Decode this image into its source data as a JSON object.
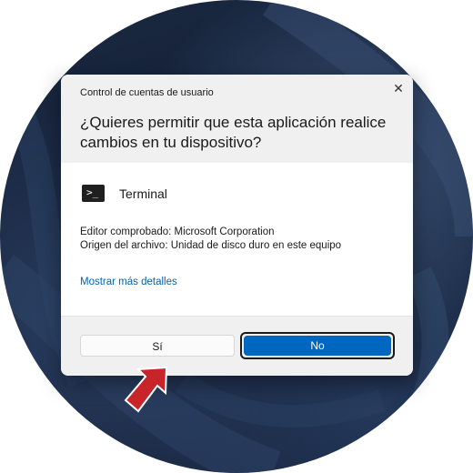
{
  "dialog": {
    "window_title": "Control de cuentas de usuario",
    "question": "¿Quieres permitir que esta aplicación realice cambios en tu dispositivo?",
    "app_name": "Terminal",
    "publisher": "Editor comprobado: Microsoft Corporation",
    "origin": "Origen del archivo: Unidad de disco duro en este equipo",
    "details_link": "Mostrar más detalles",
    "yes_label": "Sí",
    "no_label": "No",
    "close_glyph": "✕",
    "app_icon_glyph": ">_"
  },
  "colors": {
    "primary_button": "#0067c0",
    "link": "#0063b1",
    "arrow": "#c8252b"
  },
  "icons": {
    "app_icon": "terminal-icon",
    "close": "close-icon",
    "pointer": "red-arrow-icon"
  }
}
